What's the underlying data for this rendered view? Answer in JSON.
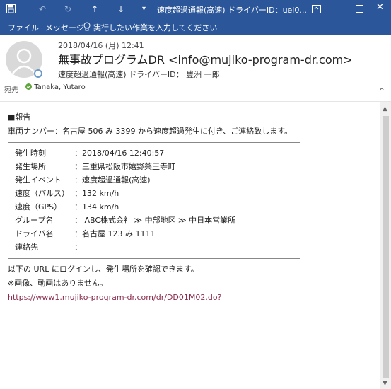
{
  "window": {
    "title": "速度超過通報(高速)  ドライバーID：uel0...",
    "icons": {
      "save": "save-icon",
      "undo": "undo-icon",
      "redo": "redo-icon",
      "up": "arrow-up-icon",
      "down": "arrow-down-icon",
      "more": "customize-toolbar-icon"
    },
    "controls": {
      "ribbon": "ribbon-display-icon",
      "minimize": "minimize-icon",
      "maximize": "maximize-icon",
      "close": "close-icon"
    }
  },
  "menu": {
    "file": "ファイル",
    "message": "メッセージ",
    "tell_me": "実行したい作業を入力してください"
  },
  "mail": {
    "date": "2018/04/16 (月) 12:41",
    "from": "無事故プログラムDR <info@mujiko-program-dr.com>",
    "subject": "速度超過通報(高速)  ドライバーID：  豊洲  一郎",
    "to_label": "宛先",
    "to_name": "Tanaka, Yutaro"
  },
  "body": {
    "heading": "■報告",
    "intro": "車両ナンバー：名古屋 506 み 3399 から速度超過発生に付き、ご連絡致します。",
    "fields": [
      {
        "label": "発生時刻",
        "value": "：2018/04/16 12:40:57"
      },
      {
        "label": "発生場所",
        "value": "：三重県松阪市嬉野薬王寺町"
      },
      {
        "label": "発生イベント",
        "value": "：速度超過通報(高速)"
      },
      {
        "label": "速度（パルス）",
        "value": "：132 km/h"
      },
      {
        "label": "速度（GPS）",
        "value": "：134 km/h"
      },
      {
        "label": "グループ名",
        "value": "：  ABC株式会社   ≫   中部地区   ≫   中日本営業所"
      },
      {
        "label": "ドライバ名",
        "value": "：名古屋  123 み  1111"
      },
      {
        "label": "連絡先",
        "value": "："
      }
    ],
    "footer1": "以下の URL にログインし、発生場所を確認できます。",
    "footer2": "※画像、動画はありません。",
    "url": "https://www1.mujiko-program-dr.com/dr/DD01M02.do?"
  }
}
